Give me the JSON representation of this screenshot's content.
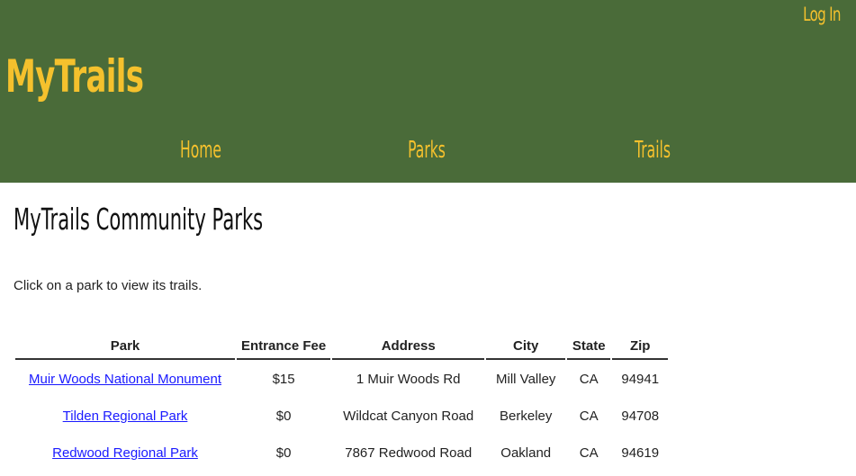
{
  "header": {
    "login_label": "Log In",
    "logo_text": "MyTrails",
    "nav": {
      "home": "Home",
      "parks": "Parks",
      "trails": "Trails"
    },
    "background_color": "#4a6b39",
    "accent_color": "#f5c12d"
  },
  "main": {
    "title": "MyTrails Community Parks",
    "intro": "Click on a park to view its trails.",
    "table": {
      "headers": [
        "Park",
        "Entrance Fee",
        "Address",
        "City",
        "State",
        "Zip"
      ],
      "rows": [
        {
          "park": "Muir Woods National Monument",
          "fee": "$15",
          "address": "1 Muir Woods Rd",
          "city": "Mill Valley",
          "state": "CA",
          "zip": "94941"
        },
        {
          "park": "Tilden Regional Park",
          "fee": "$0",
          "address": "Wildcat Canyon Road",
          "city": "Berkeley",
          "state": "CA",
          "zip": "94708"
        },
        {
          "park": "Redwood Regional Park",
          "fee": "$0",
          "address": "7867 Redwood Road",
          "city": "Oakland",
          "state": "CA",
          "zip": "94619"
        }
      ]
    }
  }
}
